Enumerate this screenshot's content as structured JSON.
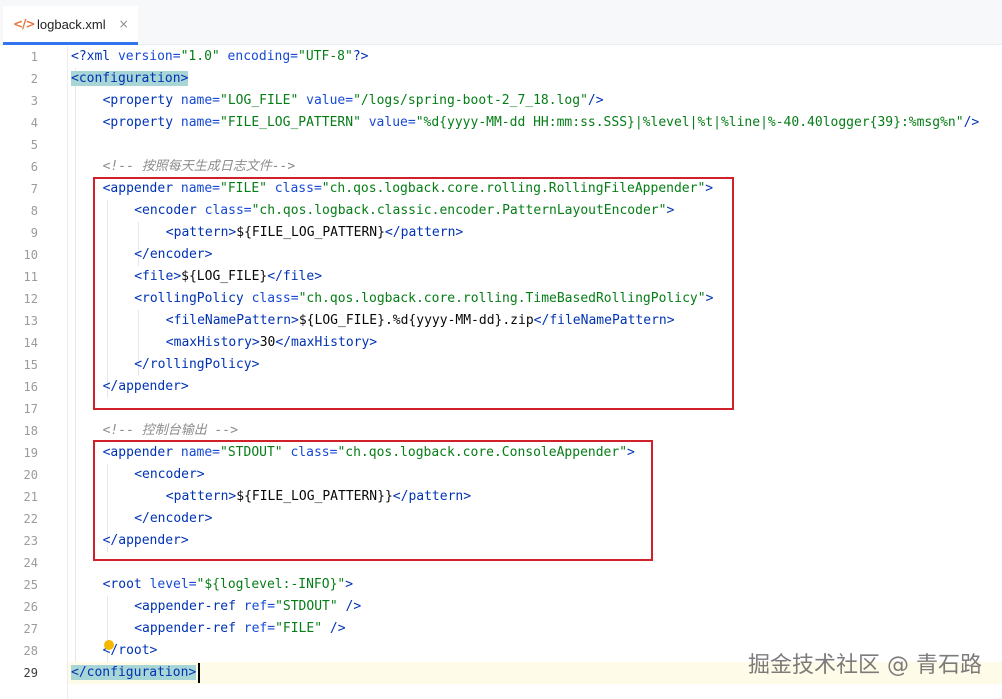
{
  "tab": {
    "icon": "code-file-icon",
    "glyph": "</>",
    "label": "logback.xml",
    "close": "×"
  },
  "current_line": 29,
  "lines": [
    {
      "n": "1",
      "tokens": [
        {
          "t": "<?",
          "c": "pi"
        },
        {
          "t": "xml ",
          "c": "pi"
        },
        {
          "t": "version=",
          "c": "attr"
        },
        {
          "t": "\"1.0\"",
          "c": "str"
        },
        {
          "t": " encoding=",
          "c": "attr"
        },
        {
          "t": "\"UTF-8\"",
          "c": "str"
        },
        {
          "t": "?>",
          "c": "pi"
        }
      ]
    },
    {
      "n": "2",
      "tokens": [
        {
          "t": "<configuration>",
          "c": "tag",
          "hl": true
        }
      ]
    },
    {
      "n": "3",
      "indent": 4,
      "tokens": [
        {
          "t": "<property ",
          "c": "tag"
        },
        {
          "t": "name=",
          "c": "attr"
        },
        {
          "t": "\"LOG_FILE\"",
          "c": "str"
        },
        {
          "t": " value=",
          "c": "attr"
        },
        {
          "t": "\"/logs/spring-boot-2_7_18.log\"",
          "c": "str"
        },
        {
          "t": "/>",
          "c": "tag"
        }
      ]
    },
    {
      "n": "4",
      "indent": 4,
      "tokens": [
        {
          "t": "<property ",
          "c": "tag"
        },
        {
          "t": "name=",
          "c": "attr"
        },
        {
          "t": "\"FILE_LOG_PATTERN\"",
          "c": "str"
        },
        {
          "t": " value=",
          "c": "attr"
        },
        {
          "t": "\"%d{yyyy-MM-dd HH:mm:ss.SSS}|%level|%t|%line|%-40.40logger{39}:%msg%n\"",
          "c": "str"
        },
        {
          "t": "/>",
          "c": "tag"
        }
      ]
    },
    {
      "n": "5",
      "tokens": []
    },
    {
      "n": "6",
      "indent": 4,
      "tokens": [
        {
          "t": "<!-- 按照每天生成日志文件-->",
          "c": "cmt"
        }
      ]
    },
    {
      "n": "7",
      "indent": 4,
      "tokens": [
        {
          "t": "<appender ",
          "c": "tag"
        },
        {
          "t": "name=",
          "c": "attr"
        },
        {
          "t": "\"FILE\"",
          "c": "str"
        },
        {
          "t": " class=",
          "c": "attr"
        },
        {
          "t": "\"ch.qos.logback.core.rolling.RollingFileAppender\"",
          "c": "str"
        },
        {
          "t": ">",
          "c": "tag"
        }
      ]
    },
    {
      "n": "8",
      "indent": 8,
      "tokens": [
        {
          "t": "<encoder ",
          "c": "tag"
        },
        {
          "t": "class=",
          "c": "attr"
        },
        {
          "t": "\"ch.qos.logback.classic.encoder.PatternLayoutEncoder\"",
          "c": "str"
        },
        {
          "t": ">",
          "c": "tag"
        }
      ]
    },
    {
      "n": "9",
      "indent": 12,
      "tokens": [
        {
          "t": "<pattern>",
          "c": "tag"
        },
        {
          "t": "${FILE_LOG_PATTERN}",
          "c": "txt"
        },
        {
          "t": "</pattern>",
          "c": "tag"
        }
      ]
    },
    {
      "n": "10",
      "indent": 8,
      "tokens": [
        {
          "t": "</encoder>",
          "c": "tag"
        }
      ]
    },
    {
      "n": "11",
      "indent": 8,
      "tokens": [
        {
          "t": "<file>",
          "c": "tag"
        },
        {
          "t": "${LOG_FILE}",
          "c": "txt"
        },
        {
          "t": "</file>",
          "c": "tag"
        }
      ]
    },
    {
      "n": "12",
      "indent": 8,
      "tokens": [
        {
          "t": "<rollingPolicy ",
          "c": "tag"
        },
        {
          "t": "class=",
          "c": "attr"
        },
        {
          "t": "\"ch.qos.logback.core.rolling.TimeBasedRollingPolicy\"",
          "c": "str"
        },
        {
          "t": ">",
          "c": "tag"
        }
      ]
    },
    {
      "n": "13",
      "indent": 12,
      "tokens": [
        {
          "t": "<fileNamePattern>",
          "c": "tag"
        },
        {
          "t": "${LOG_FILE}.%d{yyyy-MM-dd}.zip",
          "c": "txt"
        },
        {
          "t": "</fileNamePattern>",
          "c": "tag"
        }
      ]
    },
    {
      "n": "14",
      "indent": 12,
      "tokens": [
        {
          "t": "<maxHistory>",
          "c": "tag"
        },
        {
          "t": "30",
          "c": "txt"
        },
        {
          "t": "</maxHistory>",
          "c": "tag"
        }
      ]
    },
    {
      "n": "15",
      "indent": 8,
      "tokens": [
        {
          "t": "</rollingPolicy>",
          "c": "tag"
        }
      ]
    },
    {
      "n": "16",
      "indent": 4,
      "tokens": [
        {
          "t": "</appender>",
          "c": "tag"
        }
      ]
    },
    {
      "n": "17",
      "tokens": []
    },
    {
      "n": "18",
      "indent": 4,
      "tokens": [
        {
          "t": "<!-- 控制台输出 -->",
          "c": "cmt"
        }
      ]
    },
    {
      "n": "19",
      "indent": 4,
      "tokens": [
        {
          "t": "<appender ",
          "c": "tag"
        },
        {
          "t": "name=",
          "c": "attr"
        },
        {
          "t": "\"STDOUT\"",
          "c": "str"
        },
        {
          "t": " class=",
          "c": "attr"
        },
        {
          "t": "\"ch.qos.logback.core.ConsoleAppender\"",
          "c": "str"
        },
        {
          "t": ">",
          "c": "tag"
        }
      ]
    },
    {
      "n": "20",
      "indent": 8,
      "tokens": [
        {
          "t": "<encoder>",
          "c": "tag"
        }
      ]
    },
    {
      "n": "21",
      "indent": 12,
      "tokens": [
        {
          "t": "<pattern>",
          "c": "tag"
        },
        {
          "t": "${FILE_LOG_PATTERN}}",
          "c": "txt"
        },
        {
          "t": "</pattern>",
          "c": "tag"
        }
      ]
    },
    {
      "n": "22",
      "indent": 8,
      "tokens": [
        {
          "t": "</encoder>",
          "c": "tag"
        }
      ]
    },
    {
      "n": "23",
      "indent": 4,
      "tokens": [
        {
          "t": "</appender>",
          "c": "tag"
        }
      ]
    },
    {
      "n": "24",
      "tokens": []
    },
    {
      "n": "25",
      "indent": 4,
      "tokens": [
        {
          "t": "<root ",
          "c": "tag"
        },
        {
          "t": "level=",
          "c": "attr"
        },
        {
          "t": "\"${loglevel:-INFO}\"",
          "c": "str"
        },
        {
          "t": ">",
          "c": "tag"
        }
      ]
    },
    {
      "n": "26",
      "indent": 8,
      "tokens": [
        {
          "t": "<appender-ref ",
          "c": "tag"
        },
        {
          "t": "ref=",
          "c": "attr"
        },
        {
          "t": "\"STDOUT\"",
          "c": "str"
        },
        {
          "t": " />",
          "c": "tag"
        }
      ]
    },
    {
      "n": "27",
      "indent": 8,
      "tokens": [
        {
          "t": "<appender-ref ",
          "c": "tag"
        },
        {
          "t": "ref=",
          "c": "attr"
        },
        {
          "t": "\"FILE\"",
          "c": "str"
        },
        {
          "t": " />",
          "c": "tag"
        }
      ]
    },
    {
      "n": "28",
      "indent": 4,
      "tokens": [
        {
          "t": "</root>",
          "c": "tag"
        }
      ]
    },
    {
      "n": "29",
      "tokens": [
        {
          "t": "</configuration>",
          "c": "tag",
          "hl": true
        }
      ]
    }
  ],
  "colors": {
    "tag": "#0033b3",
    "attr": "#174ad4",
    "string": "#067d17",
    "comment": "#8c8c8c",
    "highlight_box": "#d0202a"
  },
  "watermark": "掘金技术社区 @ 青石路"
}
